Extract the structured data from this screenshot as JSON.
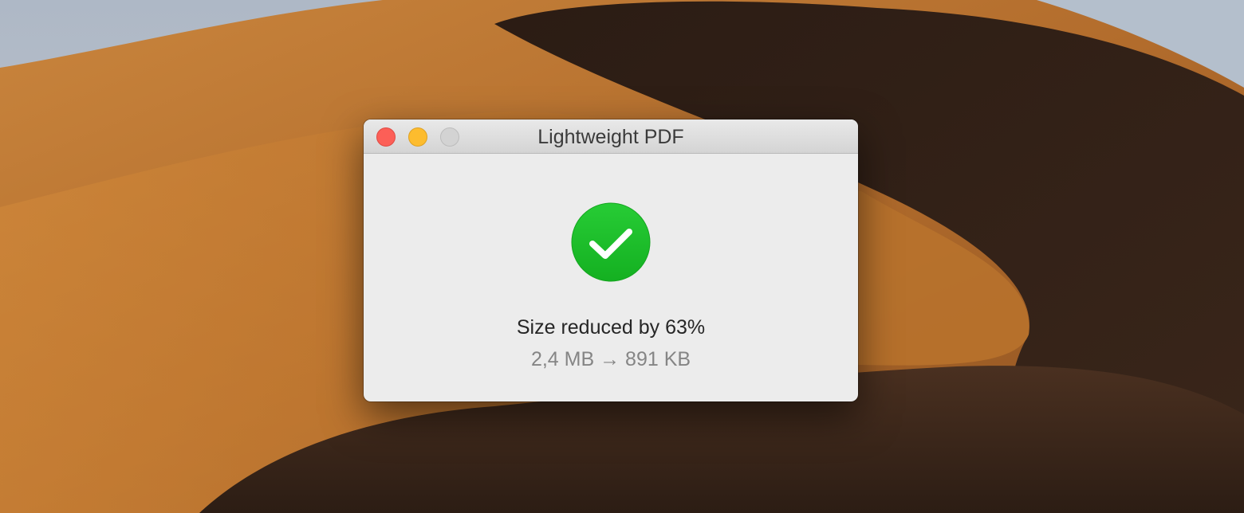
{
  "window": {
    "title": "Lightweight PDF",
    "controls": {
      "close": "close",
      "minimize": "minimize",
      "zoom": "zoom"
    }
  },
  "result": {
    "icon": "checkmark-circle-icon",
    "icon_color": "#1ec22b",
    "headline": "Size reduced by 63%",
    "original_size": "2,4 MB",
    "arrow": "→",
    "new_size": "891 KB"
  },
  "colors": {
    "close": "#fc5f57",
    "minimize": "#fdbc2e",
    "zoom_inactive": "#d3d3d3"
  }
}
